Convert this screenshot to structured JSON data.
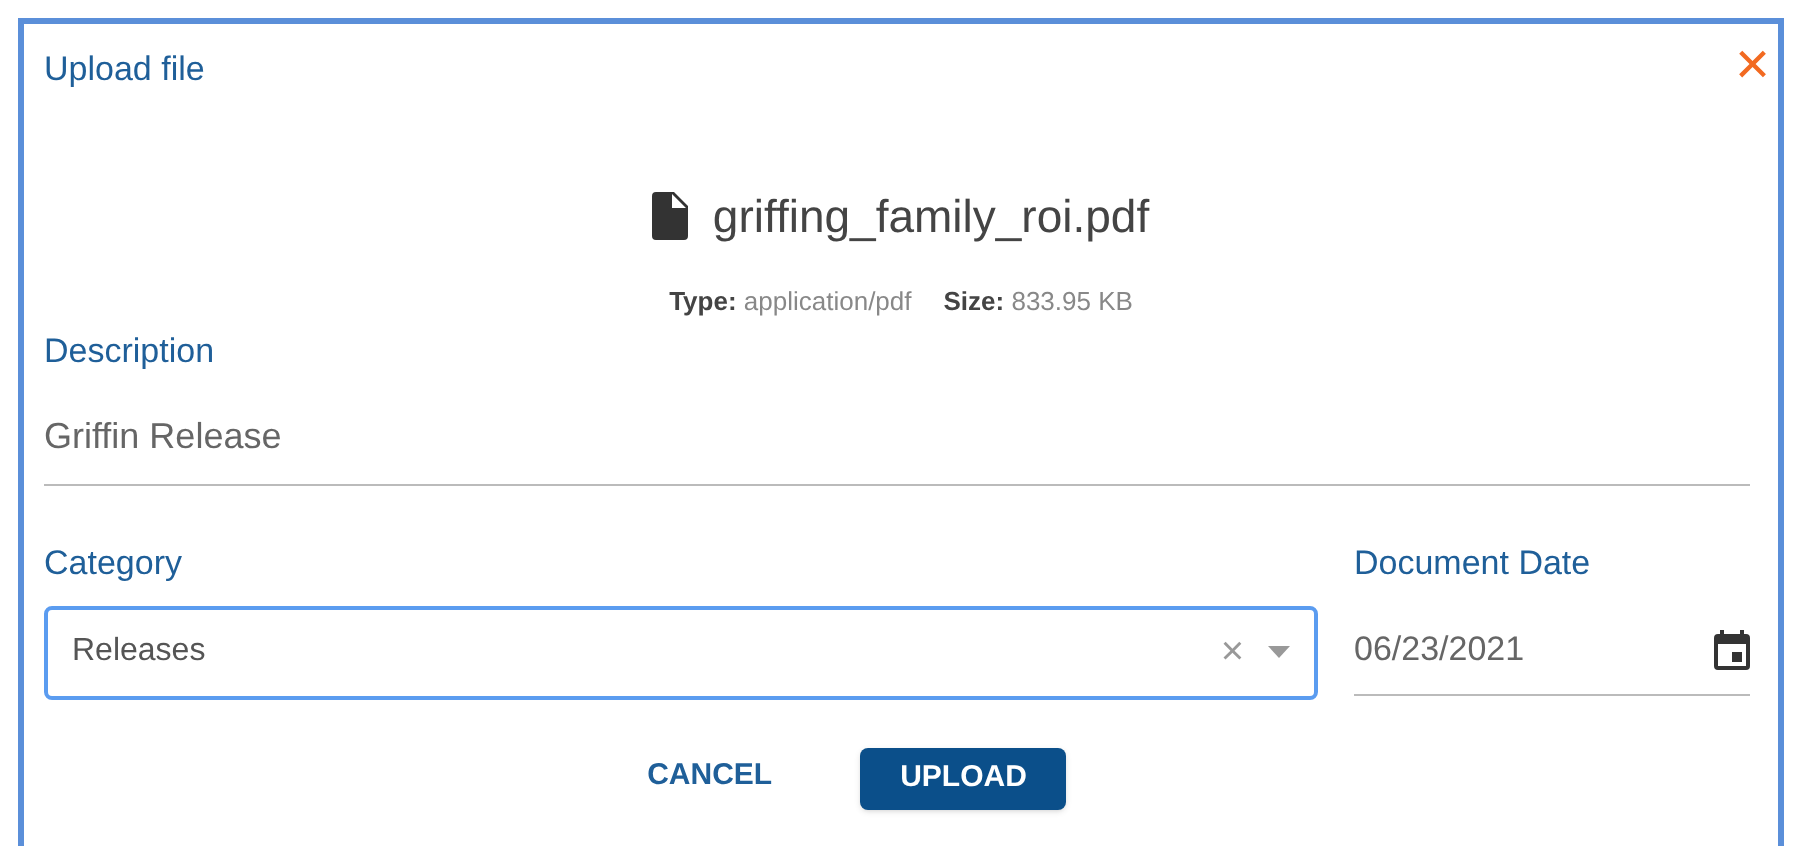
{
  "dialog": {
    "title": "Upload file",
    "close": "×"
  },
  "file": {
    "name": "griffing_family_roi.pdf",
    "type_label": "Type:",
    "type": "application/pdf",
    "size_label": "Size:",
    "size": "833.95 KB"
  },
  "description": {
    "label": "Description",
    "value": "Griffin Release"
  },
  "category": {
    "label": "Category",
    "value": "Releases",
    "focused": true,
    "clear": "×"
  },
  "document_date": {
    "label": "Document Date",
    "value": "06/23/2021"
  },
  "buttons": [
    {
      "label": "CANCEL",
      "kind": "text"
    },
    {
      "label": "UPLOAD",
      "kind": "primary"
    }
  ]
}
